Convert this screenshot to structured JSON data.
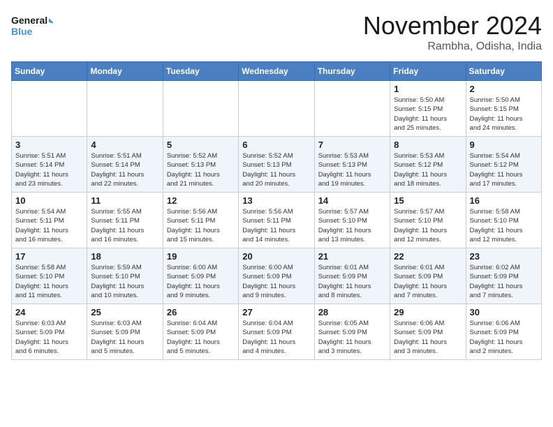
{
  "header": {
    "logo_line1": "General",
    "logo_line2": "Blue",
    "month": "November 2024",
    "location": "Rambha, Odisha, India"
  },
  "weekdays": [
    "Sunday",
    "Monday",
    "Tuesday",
    "Wednesday",
    "Thursday",
    "Friday",
    "Saturday"
  ],
  "weeks": [
    [
      {
        "day": "",
        "info": ""
      },
      {
        "day": "",
        "info": ""
      },
      {
        "day": "",
        "info": ""
      },
      {
        "day": "",
        "info": ""
      },
      {
        "day": "",
        "info": ""
      },
      {
        "day": "1",
        "info": "Sunrise: 5:50 AM\nSunset: 5:15 PM\nDaylight: 11 hours\nand 25 minutes."
      },
      {
        "day": "2",
        "info": "Sunrise: 5:50 AM\nSunset: 5:15 PM\nDaylight: 11 hours\nand 24 minutes."
      }
    ],
    [
      {
        "day": "3",
        "info": "Sunrise: 5:51 AM\nSunset: 5:14 PM\nDaylight: 11 hours\nand 23 minutes."
      },
      {
        "day": "4",
        "info": "Sunrise: 5:51 AM\nSunset: 5:14 PM\nDaylight: 11 hours\nand 22 minutes."
      },
      {
        "day": "5",
        "info": "Sunrise: 5:52 AM\nSunset: 5:13 PM\nDaylight: 11 hours\nand 21 minutes."
      },
      {
        "day": "6",
        "info": "Sunrise: 5:52 AM\nSunset: 5:13 PM\nDaylight: 11 hours\nand 20 minutes."
      },
      {
        "day": "7",
        "info": "Sunrise: 5:53 AM\nSunset: 5:13 PM\nDaylight: 11 hours\nand 19 minutes."
      },
      {
        "day": "8",
        "info": "Sunrise: 5:53 AM\nSunset: 5:12 PM\nDaylight: 11 hours\nand 18 minutes."
      },
      {
        "day": "9",
        "info": "Sunrise: 5:54 AM\nSunset: 5:12 PM\nDaylight: 11 hours\nand 17 minutes."
      }
    ],
    [
      {
        "day": "10",
        "info": "Sunrise: 5:54 AM\nSunset: 5:11 PM\nDaylight: 11 hours\nand 16 minutes."
      },
      {
        "day": "11",
        "info": "Sunrise: 5:55 AM\nSunset: 5:11 PM\nDaylight: 11 hours\nand 16 minutes."
      },
      {
        "day": "12",
        "info": "Sunrise: 5:56 AM\nSunset: 5:11 PM\nDaylight: 11 hours\nand 15 minutes."
      },
      {
        "day": "13",
        "info": "Sunrise: 5:56 AM\nSunset: 5:11 PM\nDaylight: 11 hours\nand 14 minutes."
      },
      {
        "day": "14",
        "info": "Sunrise: 5:57 AM\nSunset: 5:10 PM\nDaylight: 11 hours\nand 13 minutes."
      },
      {
        "day": "15",
        "info": "Sunrise: 5:57 AM\nSunset: 5:10 PM\nDaylight: 11 hours\nand 12 minutes."
      },
      {
        "day": "16",
        "info": "Sunrise: 5:58 AM\nSunset: 5:10 PM\nDaylight: 11 hours\nand 12 minutes."
      }
    ],
    [
      {
        "day": "17",
        "info": "Sunrise: 5:58 AM\nSunset: 5:10 PM\nDaylight: 11 hours\nand 11 minutes."
      },
      {
        "day": "18",
        "info": "Sunrise: 5:59 AM\nSunset: 5:10 PM\nDaylight: 11 hours\nand 10 minutes."
      },
      {
        "day": "19",
        "info": "Sunrise: 6:00 AM\nSunset: 5:09 PM\nDaylight: 11 hours\nand 9 minutes."
      },
      {
        "day": "20",
        "info": "Sunrise: 6:00 AM\nSunset: 5:09 PM\nDaylight: 11 hours\nand 9 minutes."
      },
      {
        "day": "21",
        "info": "Sunrise: 6:01 AM\nSunset: 5:09 PM\nDaylight: 11 hours\nand 8 minutes."
      },
      {
        "day": "22",
        "info": "Sunrise: 6:01 AM\nSunset: 5:09 PM\nDaylight: 11 hours\nand 7 minutes."
      },
      {
        "day": "23",
        "info": "Sunrise: 6:02 AM\nSunset: 5:09 PM\nDaylight: 11 hours\nand 7 minutes."
      }
    ],
    [
      {
        "day": "24",
        "info": "Sunrise: 6:03 AM\nSunset: 5:09 PM\nDaylight: 11 hours\nand 6 minutes."
      },
      {
        "day": "25",
        "info": "Sunrise: 6:03 AM\nSunset: 5:09 PM\nDaylight: 11 hours\nand 5 minutes."
      },
      {
        "day": "26",
        "info": "Sunrise: 6:04 AM\nSunset: 5:09 PM\nDaylight: 11 hours\nand 5 minutes."
      },
      {
        "day": "27",
        "info": "Sunrise: 6:04 AM\nSunset: 5:09 PM\nDaylight: 11 hours\nand 4 minutes."
      },
      {
        "day": "28",
        "info": "Sunrise: 6:05 AM\nSunset: 5:09 PM\nDaylight: 11 hours\nand 3 minutes."
      },
      {
        "day": "29",
        "info": "Sunrise: 6:06 AM\nSunset: 5:09 PM\nDaylight: 11 hours\nand 3 minutes."
      },
      {
        "day": "30",
        "info": "Sunrise: 6:06 AM\nSunset: 5:09 PM\nDaylight: 11 hours\nand 2 minutes."
      }
    ]
  ]
}
